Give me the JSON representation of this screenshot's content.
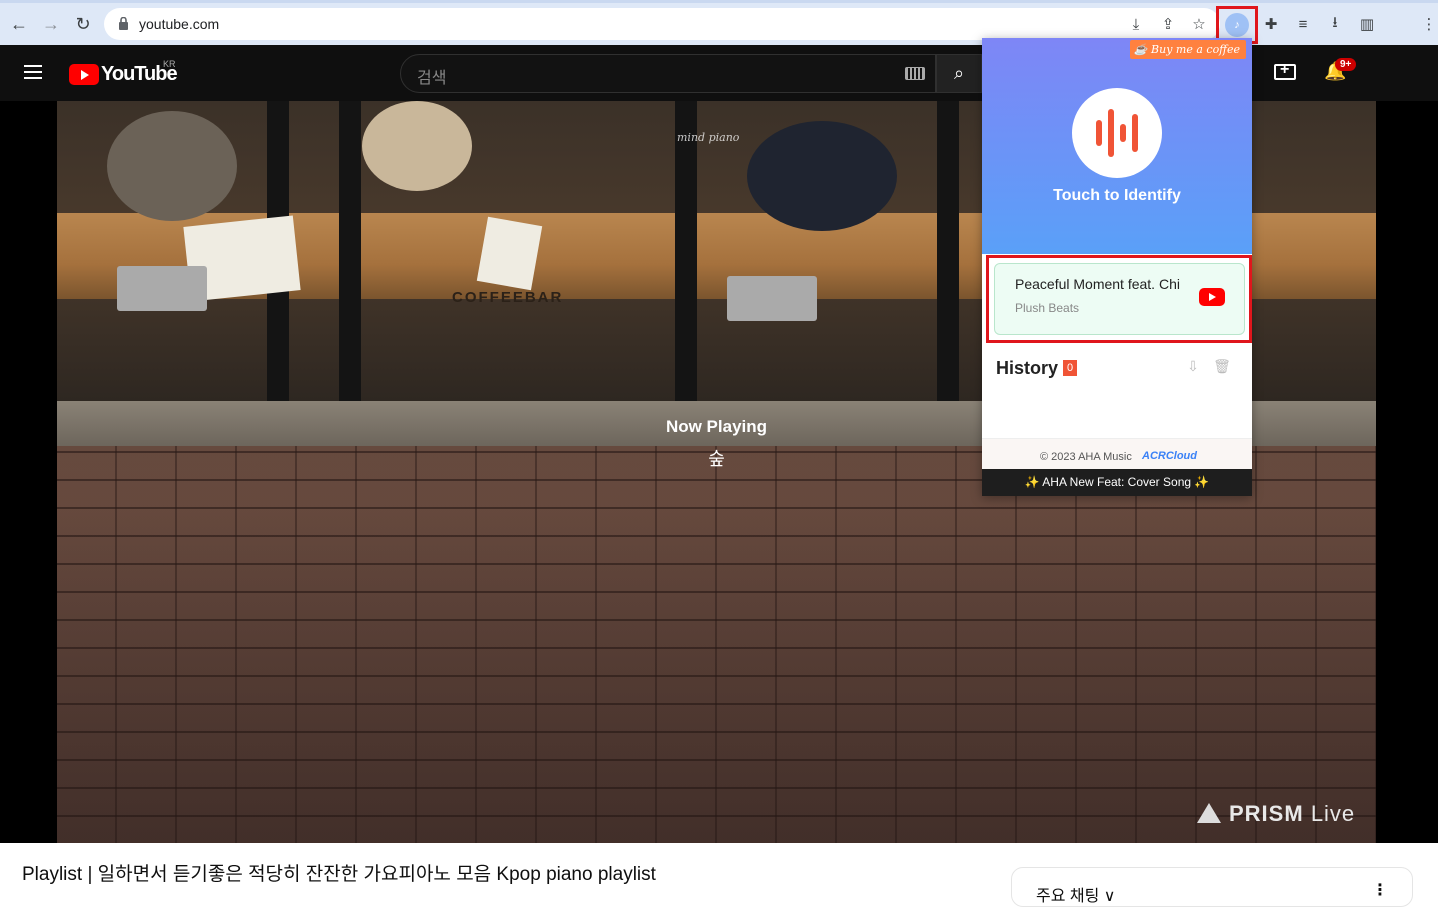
{
  "browser": {
    "url": "youtube.com",
    "back_icon": "←",
    "forward_icon": "→",
    "reload_icon": "↻",
    "tools": [
      "⤓",
      "⇪",
      "☆",
      "✚",
      "≡",
      "⭳",
      "▥",
      "⋮"
    ]
  },
  "youtube": {
    "logo_text": "YouTube",
    "region": "KR",
    "search_placeholder": "검색",
    "search_icon": "⌕",
    "bell_icon": "🔔",
    "notifications": "9+"
  },
  "video": {
    "now_playing_label": "Now Playing",
    "now_playing_song": "숲",
    "watermark_brand": "PRISM",
    "watermark_live": "Live",
    "logo_text": "mind piano",
    "sign_text": "COFFEEBAR",
    "title": "Playlist | 일하면서 듣기좋은 적당히 잔잔한 가요피아노 모음 Kpop piano playlist"
  },
  "sidebar": {
    "chip_label": "주요 채팅 ∨",
    "menu": "⋮"
  },
  "aha_popup": {
    "coffee_label": "Buy me a coffee",
    "touch_label": "Touch to Identify",
    "result_title": "Peaceful Moment feat. Chi",
    "result_artist": "Plush Beats",
    "history_label": "History",
    "history_count": "0",
    "footer_copy": "© 2023 AHA Music",
    "footer_acr": "ACRCloud",
    "new_feat": "✨ AHA New Feat: Cover Song ✨",
    "accent_color": "#f05436"
  }
}
